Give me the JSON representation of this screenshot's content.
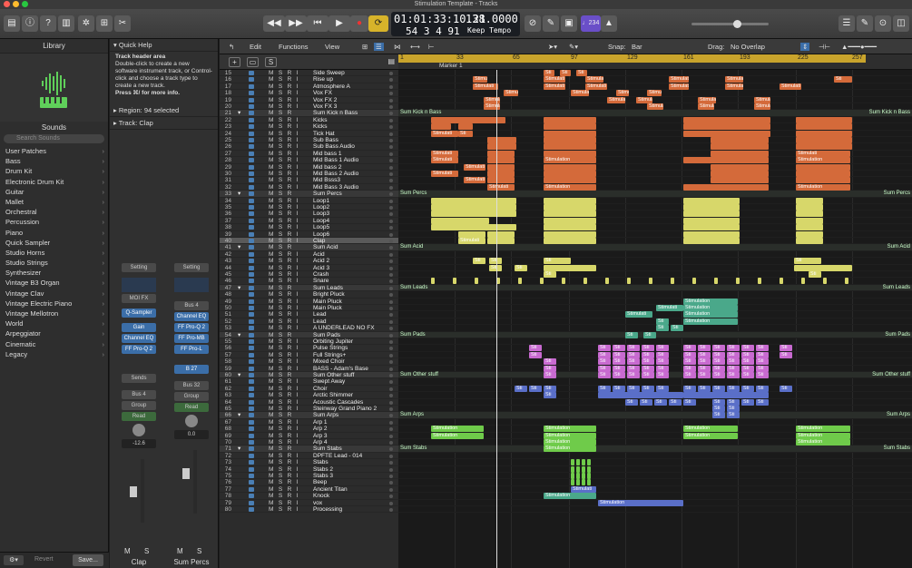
{
  "window": {
    "title": "Stimulation Template - Tracks"
  },
  "colors": {
    "green": "#6fcb4a",
    "orange": "#d46a3a",
    "yellow": "#d7d76a",
    "purple": "#c86ad0",
    "blue": "#5a6fc8",
    "teal": "#4aa88a"
  },
  "toolbar": {
    "lcd_time": "01:01:33:10.21",
    "lcd_tempo": "138.0000",
    "lcd_bars": "54  3  4     91",
    "lcd_mode": "Keep Tempo",
    "count_badge": "♩234",
    "icons": [
      "library-icon",
      "info-icon",
      "help-icon",
      "mixer-icon",
      "settings-icon",
      "scissors-icon",
      "rewind-icon",
      "fast-forward-icon",
      "to-start-icon",
      "play-icon",
      "record-icon",
      "cycle-icon",
      "tuner-icon",
      "pencil-icon",
      "metronome-icon",
      "volume-slider",
      "list-icon",
      "notes-icon",
      "loop-icon",
      "browser-icon",
      "media-icon"
    ]
  },
  "library": {
    "header": "Library",
    "sounds_label": "Sounds",
    "search_placeholder": "Search Sounds",
    "items": [
      "User Patches",
      "Bass",
      "Drum Kit",
      "Electronic Drum Kit",
      "Guitar",
      "Mallet",
      "Orchestral",
      "Percussion",
      "Piano",
      "Quick Sampler",
      "Studio Horns",
      "Studio Strings",
      "Synthesizer",
      "Vintage B3 Organ",
      "Vintage Clav",
      "Vintage Electric Piano",
      "Vintage Mellotron",
      "World",
      "Arpeggiator",
      "Cinematic",
      "Legacy"
    ],
    "revert_label": "Revert",
    "save_label": "Save..."
  },
  "inspector": {
    "quick_help_title": "Quick Help",
    "qh_heading": "Track header area",
    "qh_body": "Double-click to create a new software instrument track, or Control-click and choose a track type to create a new track.",
    "qh_more": "Press ⌘/ for more info.",
    "region_label": "Region:",
    "region_value": "94 selected",
    "track_label": "Track:",
    "track_value": "Clap",
    "strip1": {
      "setting": "Setting",
      "fx": "MOI FX",
      "inst": "Q-Sampler",
      "inserts": [
        "Gain",
        "Channel EQ",
        "FF Pro-Q 2"
      ],
      "sends": "Sends",
      "out": "Bus 4",
      "group": "Group",
      "mode": "Read",
      "vol": "-12.6",
      "m": "M",
      "s": "S",
      "name": "Clap"
    },
    "strip2": {
      "setting": "Setting",
      "bus": "Bus 4",
      "inserts": [
        "Channel EQ",
        "FF Pro-Q 2",
        "FF Pro-MB",
        "FF Pro-L"
      ],
      "send": "B 27",
      "out": "Bus 32",
      "group": "Group",
      "mode": "Read",
      "vol": "0.0",
      "m": "M",
      "s": "S",
      "name": "Sum Percs"
    }
  },
  "tracks_toolbar": {
    "edit": "Edit",
    "functions": "Functions",
    "view": "View",
    "snap_label": "Snap:",
    "snap_value": "Bar",
    "drag_label": "Drag:",
    "drag_value": "No Overlap"
  },
  "ruler": {
    "bars": [
      "1",
      "33",
      "65",
      "97",
      "129",
      "161",
      "193",
      "225",
      "257"
    ],
    "marker": "Marker 1"
  },
  "tracks": [
    {
      "n": "15",
      "name": "Side Sweep"
    },
    {
      "n": "16",
      "name": "Rise  up"
    },
    {
      "n": "17",
      "name": "Atmosphere A"
    },
    {
      "n": "18",
      "name": "Vox FX"
    },
    {
      "n": "19",
      "name": "Vox FX 2"
    },
    {
      "n": "20",
      "name": "Vox FX 3"
    },
    {
      "n": "21",
      "name": "Sum Kick n Bass",
      "sum": true
    },
    {
      "n": "22",
      "name": "Kicks"
    },
    {
      "n": "23",
      "name": "Kicks"
    },
    {
      "n": "24",
      "name": "Tick Hat"
    },
    {
      "n": "25",
      "name": "Sub Bass"
    },
    {
      "n": "26",
      "name": "Sub Bass Audio"
    },
    {
      "n": "27",
      "name": "Mid bass 1"
    },
    {
      "n": "28",
      "name": "Mid Bass 1 Audio"
    },
    {
      "n": "29",
      "name": "Mid bass 2"
    },
    {
      "n": "30",
      "name": "Mid Bass 2 Audio"
    },
    {
      "n": "31",
      "name": "Mid Bsss3"
    },
    {
      "n": "32",
      "name": "Mid Bass 3 Audio"
    },
    {
      "n": "33",
      "name": "Sum Percs",
      "sum": true
    },
    {
      "n": "34",
      "name": "Loop1"
    },
    {
      "n": "35",
      "name": "Loop2"
    },
    {
      "n": "36",
      "name": "Loop3"
    },
    {
      "n": "37",
      "name": "Loop4"
    },
    {
      "n": "38",
      "name": "Loop5"
    },
    {
      "n": "39",
      "name": "Loop6"
    },
    {
      "n": "40",
      "name": "Clap",
      "sel": true
    },
    {
      "n": "41",
      "name": "Sum Acid",
      "sum": true
    },
    {
      "n": "42",
      "name": "Acid"
    },
    {
      "n": "43",
      "name": "Acid 2"
    },
    {
      "n": "44",
      "name": "Acid 3"
    },
    {
      "n": "45",
      "name": "Crash"
    },
    {
      "n": "46",
      "name": "Snare"
    },
    {
      "n": "47",
      "name": "Sum Leads",
      "sum": true
    },
    {
      "n": "48",
      "name": "Bright Pluck"
    },
    {
      "n": "49",
      "name": "Main Pluck"
    },
    {
      "n": "50",
      "name": "Main Pluck"
    },
    {
      "n": "51",
      "name": "Lead"
    },
    {
      "n": "52",
      "name": "Lead"
    },
    {
      "n": "53",
      "name": "A UNDERLEAD NO FX"
    },
    {
      "n": "54",
      "name": "Sum Pads",
      "sum": true
    },
    {
      "n": "55",
      "name": "Orbiting Jupiter"
    },
    {
      "n": "56",
      "name": "Pulse Strings"
    },
    {
      "n": "57",
      "name": "Full Strings+"
    },
    {
      "n": "58",
      "name": "Mixed Choir"
    },
    {
      "n": "59",
      "name": "BASS - Adam's Base"
    },
    {
      "n": "60",
      "name": "Sum Other stuff",
      "sum": true
    },
    {
      "n": "61",
      "name": "Swept Away"
    },
    {
      "n": "62",
      "name": "Choir"
    },
    {
      "n": "63",
      "name": "Arctic Shimmer"
    },
    {
      "n": "64",
      "name": "Acoustic Cascades"
    },
    {
      "n": "65",
      "name": "Steinway Grand Piano 2"
    },
    {
      "n": "66",
      "name": "Sum Arps",
      "sum": true
    },
    {
      "n": "67",
      "name": "Arp 1"
    },
    {
      "n": "68",
      "name": "Arp 2"
    },
    {
      "n": "69",
      "name": "Arp 3"
    },
    {
      "n": "70",
      "name": "Arp 4"
    },
    {
      "n": "71",
      "name": "Sum Stabs",
      "sum": true
    },
    {
      "n": "72",
      "name": "DPFTE Lead - 014"
    },
    {
      "n": "73",
      "name": "Stabs"
    },
    {
      "n": "74",
      "name": "Stabs 2"
    },
    {
      "n": "75",
      "name": "Stabs 3"
    },
    {
      "n": "76",
      "name": "Beep"
    },
    {
      "n": "77",
      "name": "Ancient Titan"
    },
    {
      "n": "78",
      "name": "Knock"
    },
    {
      "n": "79",
      "name": "vox"
    },
    {
      "n": "80",
      "name": "Processing"
    }
  ],
  "track_button_labels": {
    "m": "M",
    "s": "S",
    "r": "R",
    "i": "I"
  },
  "region_labels": {
    "stimulation": "Stimulation",
    "stimulati": "Stimulati",
    "sti": "Sti"
  }
}
